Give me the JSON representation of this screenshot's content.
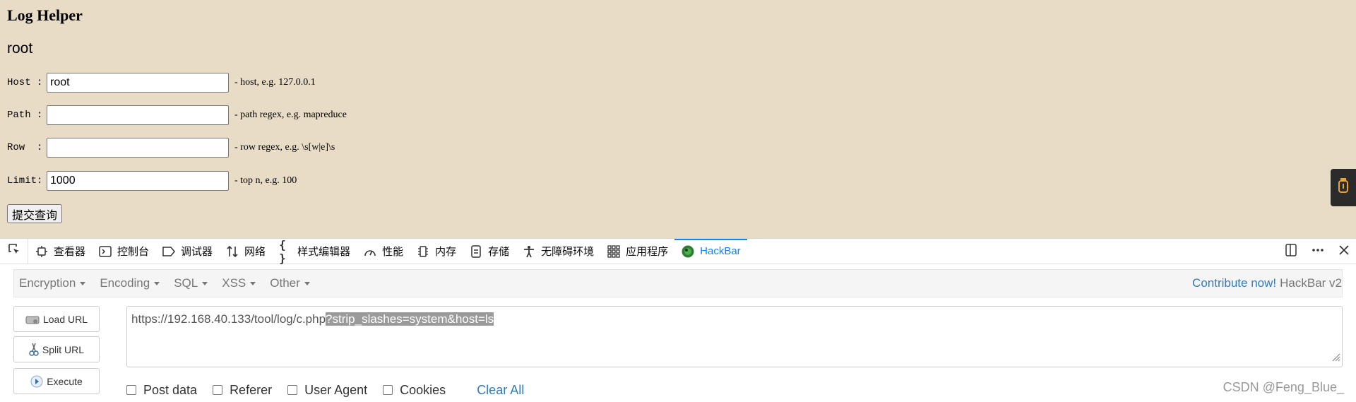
{
  "page": {
    "title": "Log Helper",
    "subtitle": "root",
    "submit_label": "提交查询",
    "fields": [
      {
        "label": "Host :",
        "value": "root",
        "hint": "- host, e.g. 127.0.0.1"
      },
      {
        "label": "Path :",
        "value": "",
        "hint": "- path regex, e.g. mapreduce"
      },
      {
        "label": "Row  :",
        "value": "",
        "hint": "- row regex, e.g. \\s[w|e]\\s"
      },
      {
        "label": "Limit:",
        "value": "1000",
        "hint": "- top n, e.g. 100"
      }
    ]
  },
  "devtools": {
    "tabs": [
      {
        "label": "查看器",
        "icon": "inspector-icon"
      },
      {
        "label": "控制台",
        "icon": "console-icon"
      },
      {
        "label": "调试器",
        "icon": "debugger-icon"
      },
      {
        "label": "网络",
        "icon": "network-icon"
      },
      {
        "label": "样式编辑器",
        "icon": "style-editor-icon"
      },
      {
        "label": "性能",
        "icon": "performance-icon"
      },
      {
        "label": "内存",
        "icon": "memory-icon"
      },
      {
        "label": "存储",
        "icon": "storage-icon"
      },
      {
        "label": "无障碍环境",
        "icon": "accessibility-icon"
      },
      {
        "label": "应用程序",
        "icon": "application-icon"
      },
      {
        "label": "HackBar",
        "icon": "hackbar-icon"
      }
    ],
    "active_tab": "HackBar",
    "accent_color": "#0a84ff"
  },
  "hackbar": {
    "menu": [
      "Encryption",
      "Encoding",
      "SQL",
      "XSS",
      "Other"
    ],
    "contribute_link": "Contribute now!",
    "version_label": "HackBar v2",
    "load_url_label": "Load URL",
    "split_url_label": "Split URL",
    "execute_label": "Execute",
    "url_plain": "https://192.168.40.133/tool/log/c.php",
    "url_selected": "?strip_slashes=system&host=ls",
    "options": [
      "Post data",
      "Referer",
      "User Agent",
      "Cookies"
    ],
    "clear_all_label": "Clear All"
  },
  "watermark": "CSDN @Feng_Blue_"
}
